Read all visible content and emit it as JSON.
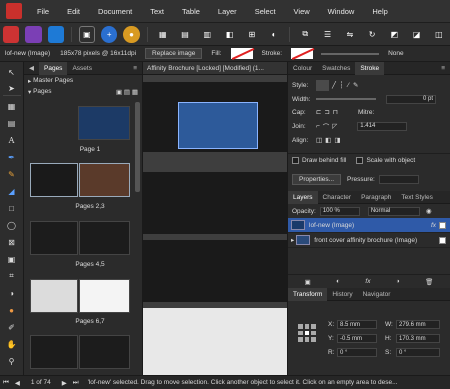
{
  "menu": [
    "File",
    "Edit",
    "Document",
    "Text",
    "Table",
    "Layer",
    "Select",
    "View",
    "Window",
    "Help"
  ],
  "context": {
    "object": "lof-new (Image)",
    "size_info": "185x78 pixels @ 16x11dpi",
    "replace_button": "Replace image",
    "fill_label": "Fill:",
    "stroke_label": "Stroke:",
    "stroke_style": "None"
  },
  "pages_panel": {
    "tabs": [
      "Pages",
      "Assets"
    ],
    "master_pages": "Master Pages",
    "pages": "Pages",
    "captions": [
      "Page 1",
      "Pages 2,3",
      "Pages 4,5",
      "Pages 6,7"
    ]
  },
  "document_tab": "Affinity Brochure [Locked] [Modified] (1...",
  "right_tabs": [
    "Colour",
    "Swatches",
    "Stroke"
  ],
  "stroke": {
    "style_label": "Style:",
    "width_label": "Width:",
    "width_value": "0 pt",
    "cap_label": "Cap:",
    "join_label": "Join:",
    "mitre_label": "Mitre:",
    "mitre_value": "1.414",
    "align_label": "Align:",
    "draw_behind": "Draw behind fill",
    "scale_with": "Scale with object",
    "properties_btn": "Properties...",
    "pressure_label": "Pressure:"
  },
  "layers": {
    "tabs": [
      "Layers",
      "Character",
      "Paragraph",
      "Text Styles"
    ],
    "opacity_label": "Opacity:",
    "opacity_value": "100 %",
    "blend": "Normal",
    "rows": [
      "lof-new (Image)",
      "front cover affinity brochure (Image)"
    ]
  },
  "transform": {
    "tabs": [
      "Transform",
      "History",
      "Navigator"
    ],
    "x_label": "X:",
    "x_value": "8.5 mm",
    "y_label": "Y:",
    "y_value": "-0.5 mm",
    "w_label": "W:",
    "w_value": "279.6 mm",
    "h_label": "H:",
    "h_value": "170.3 mm",
    "r_label": "R:",
    "r_value": "0 °",
    "s_label": "S:",
    "s_value": "0 °"
  },
  "status": {
    "page": "1 of 74",
    "message": "'lof-new' selected. Drag to move selection. Click another object to select it. Click on an empty area to dese..."
  }
}
